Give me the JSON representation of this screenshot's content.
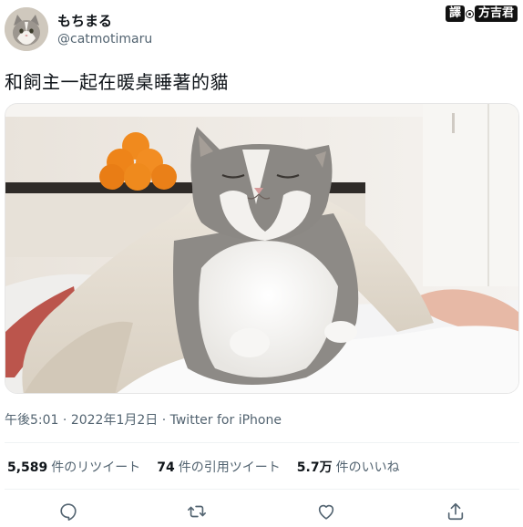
{
  "user": {
    "display_name": "もちまる",
    "handle": "@catmotimaru"
  },
  "translator_credit": {
    "prefix": "譯",
    "name": "方吉君"
  },
  "tweet": {
    "text": "和飼主一起在暖桌睡著的貓"
  },
  "meta": {
    "time": "午後5:01",
    "sep1": " · ",
    "date": "2022年1月2日",
    "sep2": " · ",
    "source": "Twitter for iPhone"
  },
  "stats": [
    {
      "count": "5,589",
      "label": "件のリツイート"
    },
    {
      "count": "74",
      "label": "件の引用ツイート"
    },
    {
      "count": "5.7万",
      "label": "件のいいね"
    }
  ],
  "actions": [
    {
      "icon": "reply-icon"
    },
    {
      "icon": "retweet-icon"
    },
    {
      "icon": "like-icon"
    },
    {
      "icon": "share-icon"
    }
  ]
}
